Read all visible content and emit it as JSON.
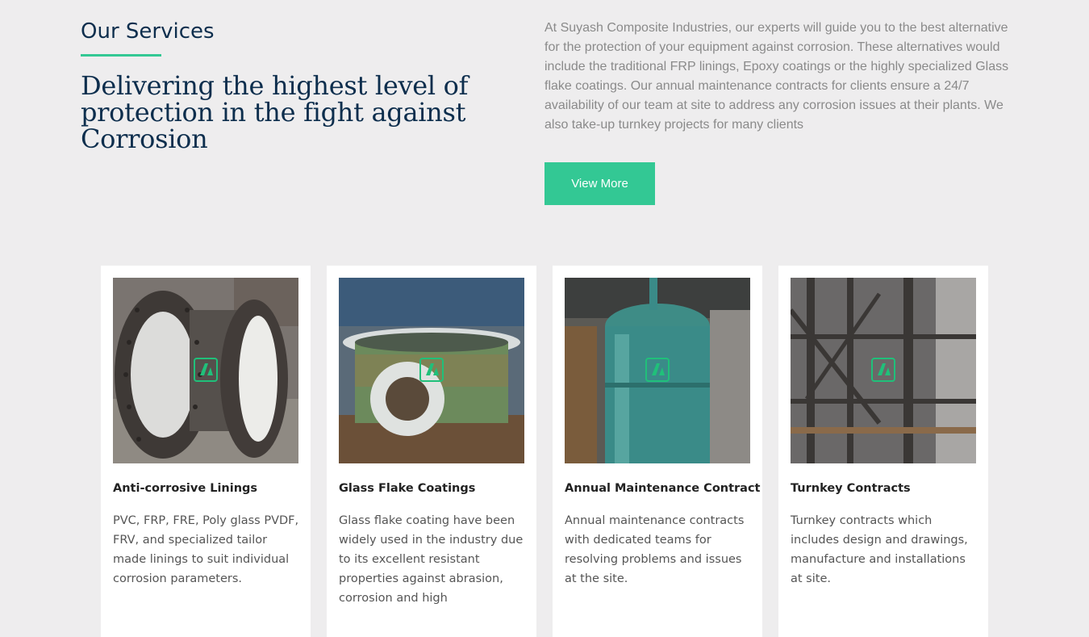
{
  "header": {
    "section_title": "Our Services",
    "headline": "Delivering the highest level of protection in the fight against Corrosion"
  },
  "intro": {
    "text": "At Suyash Composite Industries, our experts will guide you to the best alternative for the protection of your equipment against corrosion. These alternatives would include the traditional FRP linings, Epoxy coatings or the highly specialized Glass flake coatings. Our annual maintenance contracts for clients ensure a 24/7 availability of our team at site to address any corrosion issues at their plants. We also take-up turnkey projects for many clients",
    "button_label": "View More"
  },
  "services": [
    {
      "title": "Anti-corrosive Linings",
      "text": "PVC, FRP, FRE, Poly glass PVDF, FRV, and specialized tailor made linings to suit individual corrosion parameters."
    },
    {
      "title": "Glass Flake Coatings",
      "text": "Glass flake coating have been widely used in the industry due to its excellent resistant properties against abrasion, corrosion and high"
    },
    {
      "title": "Annual Maintenance Contract",
      "text": "Annual maintenance contracts with dedicated teams for resolving problems and issues at the site."
    },
    {
      "title": "Turnkey Contracts",
      "text": "Turnkey contracts which includes design and drawings, manufacture and installations at site."
    }
  ],
  "colors": {
    "accent": "#33c894",
    "heading": "#0d2e4d",
    "body_text": "#8a8a8a",
    "background": "#eeedee"
  },
  "icons": [
    "company-logo-watermark-icon"
  ]
}
